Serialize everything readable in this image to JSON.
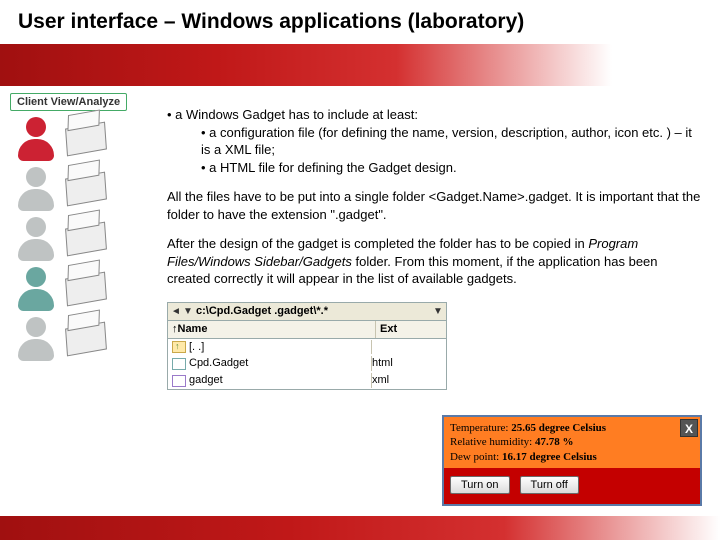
{
  "title": "User interface – Windows applications (laboratory)",
  "sidebar": {
    "heading": "Client View/Analyze"
  },
  "bullets": {
    "main": "a Windows Gadget has to include at least:",
    "sub1": "a configuration file (for defining the name, version, description, author, icon etc. ) – it is a XML file;",
    "sub2": "a HTML file for defining the Gadget design."
  },
  "para1": "All the files have to be put into a single folder <Gadget.Name>.gadget. It is important that the folder to have the extension \".gadget\".",
  "para2_a": "After the design of the gadget is completed the folder has to be copied in ",
  "para2_i": "Program Files/Windows Sidebar/Gadgets",
  "para2_b": " folder. From this moment, if the application has been created correctly it will appear in the list of available gadgets.",
  "filebrowser": {
    "path": "c:\\Cpd.Gadget .gadget\\*.*",
    "col_name": "Name",
    "col_ext": "Ext",
    "up": "[. .]",
    "r1_name": "Cpd.Gadget",
    "r1_ext": "html",
    "r2_name": "gadget",
    "r2_ext": "xml"
  },
  "gadget": {
    "t_label": "Temperature: ",
    "t_val": "25.65 degree Celsius",
    "h_label": "Relative humidity: ",
    "h_val": "47.78 %",
    "d_label": "Dew point: ",
    "d_val": "16.17 degree Celsius",
    "close": "X",
    "on": "Turn on",
    "off": "Turn off"
  }
}
